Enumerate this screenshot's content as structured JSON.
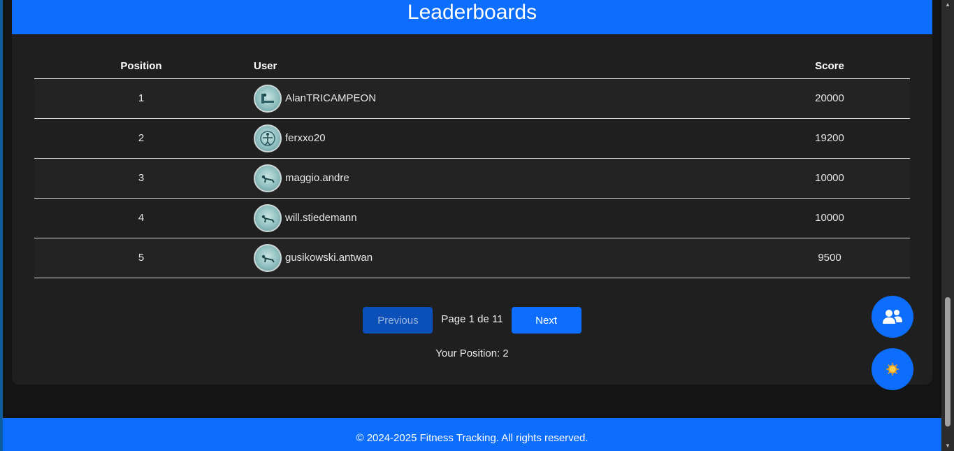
{
  "header": {
    "title": "Leaderboards"
  },
  "table": {
    "columns": {
      "position": "Position",
      "user": "User",
      "score": "Score"
    },
    "rows": [
      {
        "position": "1",
        "user": "AlanTRICAMPEON",
        "score": "20000",
        "avatar_icon": "bridge-avatar-icon"
      },
      {
        "position": "2",
        "user": "ferxxo20",
        "score": "19200",
        "avatar_icon": "vitruvian-avatar-icon"
      },
      {
        "position": "3",
        "user": "maggio.andre",
        "score": "10000",
        "avatar_icon": "pushup-avatar-icon"
      },
      {
        "position": "4",
        "user": "will.stiedemann",
        "score": "10000",
        "avatar_icon": "pushup-avatar-icon"
      },
      {
        "position": "5",
        "user": "gusikowski.antwan",
        "score": "9500",
        "avatar_icon": "pushup-avatar-icon"
      }
    ]
  },
  "pagination": {
    "previous_label": "Previous",
    "page_label": "Page 1 de 11",
    "next_label": "Next"
  },
  "your_position": "Your Position: 2",
  "fabs": {
    "friends_icon": "users-icon",
    "theme_icon": "sun-icon"
  },
  "footer": {
    "text": "© 2024-2025 Fitness Tracking. All rights reserved."
  },
  "colors": {
    "primary": "#0d6efd",
    "background": "#141414",
    "card": "#1f1f1f"
  }
}
